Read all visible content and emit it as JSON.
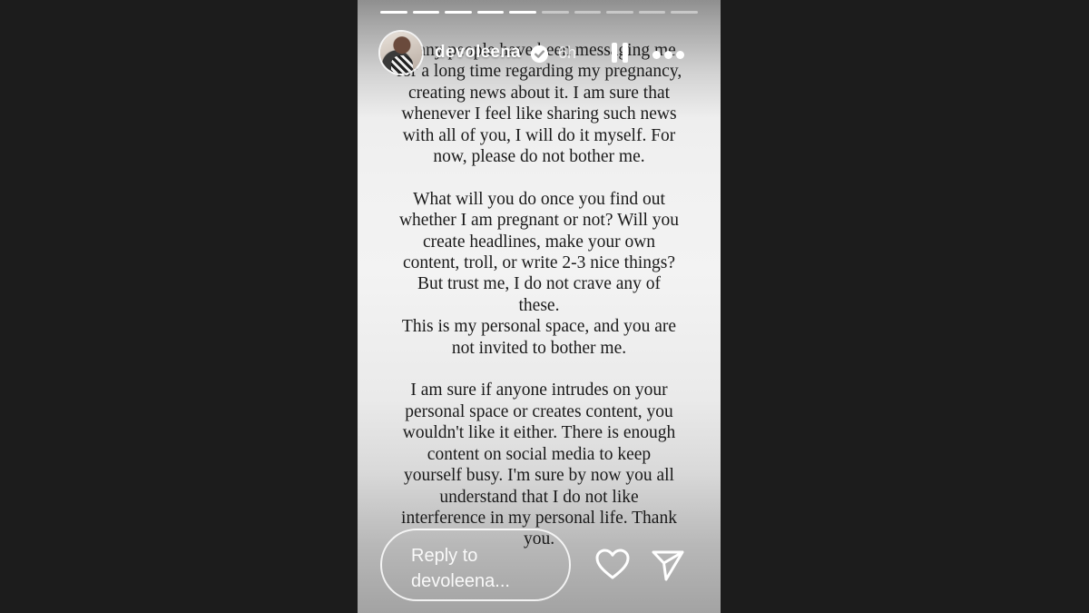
{
  "story": {
    "progress": {
      "total_segments": 10,
      "completed_segments": 5
    },
    "header": {
      "username": "devoleena",
      "verified": true,
      "time": "6h",
      "icons": {
        "avatar": "profile-photo",
        "verified": "verified-badge-icon",
        "pause": "pause-icon",
        "more": "more-options-icon"
      }
    },
    "text_lines": [
      "Many people have been messaging me",
      "for a long time regarding my pregnancy,",
      "creating news about it. I am sure that",
      "whenever I feel like sharing such news",
      "with all of you, I will do it myself. For",
      "now, please do not bother me.",
      "",
      "What will you do once you find out",
      "whether I am pregnant or not? Will you",
      "create headlines, make your own",
      "content, troll, or write 2-3 nice things?",
      "But trust me, I do not crave any of",
      "these.",
      "This is my personal space, and you are",
      "not invited to bother me.",
      "",
      "I am sure if anyone intrudes on your",
      "personal space or creates content, you",
      "wouldn't like it either. There is enough",
      "content on social media to keep",
      "yourself busy. I'm sure by now you all",
      "understand that I do not like",
      "interference in my personal life. Thank",
      "you."
    ],
    "reply": {
      "line1": "Reply to",
      "line2": "devoleena..."
    },
    "actions": {
      "like_icon": "heart-icon",
      "share_icon": "send-icon"
    }
  },
  "colors": {
    "background": "#1c1c1c",
    "text": "#1a1a1a",
    "overlay": "#ffffff"
  }
}
